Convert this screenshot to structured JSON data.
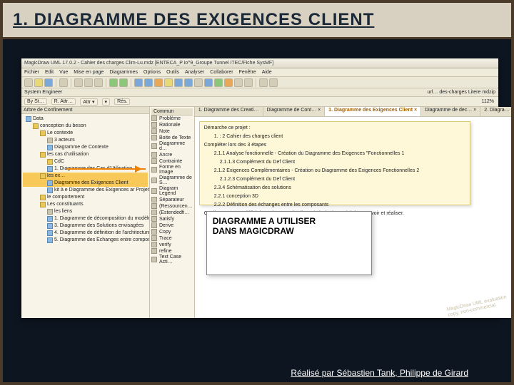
{
  "slide": {
    "title": "1. DIAGRAMME DES EXIGENCES CLIENT",
    "credit": "Réalisé par Sébastien Tank, Philippe de Girard"
  },
  "app": {
    "title": "MagicDraw UML 17.0.2 - Cahier des charges Clim-Lu.mdz [ENTECA_P io^9_Groupe Tunnel ITEC/Fiche SysMF]"
  },
  "menu": {
    "items": [
      "Fichier",
      "Edit",
      "Vue",
      "Mise en page",
      "Diagrammes",
      "Options",
      "Outils",
      "Analyser",
      "Collaborer",
      "Fenêtre",
      "Aide"
    ]
  },
  "role_row": {
    "role_label": "System Engineer",
    "url_label": "url… des-charges Litere mdzip"
  },
  "toolbar2": {
    "buttons": [
      "By St…",
      "R. Attr…",
      "Attr ▾",
      "▾",
      "Rés."
    ]
  },
  "tree_header": "Arbre de Confinement",
  "tree": [
    {
      "level": 1,
      "icon": "blue",
      "label": "Data"
    },
    {
      "level": 2,
      "icon": "yellow",
      "label": "conception du beson"
    },
    {
      "level": 3,
      "icon": "yellow",
      "label": "Le contexte"
    },
    {
      "level": 4,
      "icon": "gray",
      "label": "3 acteurs"
    },
    {
      "level": 4,
      "icon": "blue",
      "label": "Diagramme de Contexte"
    },
    {
      "level": 3,
      "icon": "yellow",
      "label": "les cas d'utilisation"
    },
    {
      "level": 4,
      "icon": "yellow",
      "label": "CdC"
    },
    {
      "level": 4,
      "icon": "blue",
      "label": "1. Diagramme des Cas d'Utilisation"
    },
    {
      "level": 3,
      "icon": "yellow",
      "label": "les ex…",
      "highlight": true
    },
    {
      "level": 4,
      "icon": "blue",
      "label": "Diagramme des Exigences Client",
      "highlight": true
    },
    {
      "level": 4,
      "icon": "blue",
      "label": "kit à e   Diagramme des Exigences   ar Projet"
    },
    {
      "level": 3,
      "icon": "yellow",
      "label": "le comportement"
    },
    {
      "level": 3,
      "icon": "yellow",
      "label": "Les constituants"
    },
    {
      "level": 4,
      "icon": "gray",
      "label": "les liens"
    },
    {
      "level": 4,
      "icon": "blue",
      "label": "1. Diagramme de décomposition du modèle en kit"
    },
    {
      "level": 4,
      "icon": "blue",
      "label": "3. Diagramme des Solutions envisagées"
    },
    {
      "level": 4,
      "icon": "blue",
      "label": "4. Diagramme de définition de l'architecture système"
    },
    {
      "level": 4,
      "icon": "blue",
      "label": "5. Diagramme des Echanges entre composants"
    }
  ],
  "mid": {
    "header": "Commun",
    "items": [
      "Problème",
      "Rationale",
      "Note",
      "Boite de Texte",
      "Diagramme d…",
      "Ancre",
      "Contrainte",
      "Forme en Image",
      "Diagramme de S…",
      "Diagram Legend",
      "Séparateur",
      "(Ressourcen…",
      "(Estendedfi…",
      "Satisfy",
      "Derive",
      "Copy",
      "Trace",
      "verify",
      "refine",
      "Text Case Acti…"
    ]
  },
  "tabs": [
    {
      "label": "1. Diagramme des Creati…"
    },
    {
      "label": "Diagramme de Cont… ×"
    },
    {
      "label": "1. Diagramme des Exigences Client ×",
      "active": true,
      "req": true
    },
    {
      "label": "Diagramme de dec… ×"
    },
    {
      "label": "2. Diagra…"
    }
  ],
  "req": {
    "line1": "Démarche ce projet :",
    "line2": "1. : 2 Cahier des charges client",
    "line3": "Compléter lors des 3 étapes",
    "line4": "2.1.1 Analyse fonctionnelle - Création du Diagramme des Exigences \"Fonctionnelles 1",
    "line5": "2.1.1.3 Complément du Def Client",
    "line6": "2.1.2 Exigences Complémentaires - Création ou Diagramme des Exigences Fonctionnelles 2",
    "line7": "2.1.2.3 Complément du Def Client",
    "line8": "2.3.4 Schématisation des solutions",
    "line9": "2.2.1 conception 3D",
    "line10": "2.2.2 Définition des échanges entre les composants",
    "line11": "Ce diagramme se définit les exigences du client vis à vis du produit à concevoir et réaliser."
  },
  "callout": {
    "line1": "DIAGRAMME A UTILISER",
    "line2": "DANS MAGICDRAW"
  },
  "watermark": {
    "l1": "MagicDraw UML evaluation",
    "l2": "copy, non-commercial"
  },
  "zoom": "112%"
}
